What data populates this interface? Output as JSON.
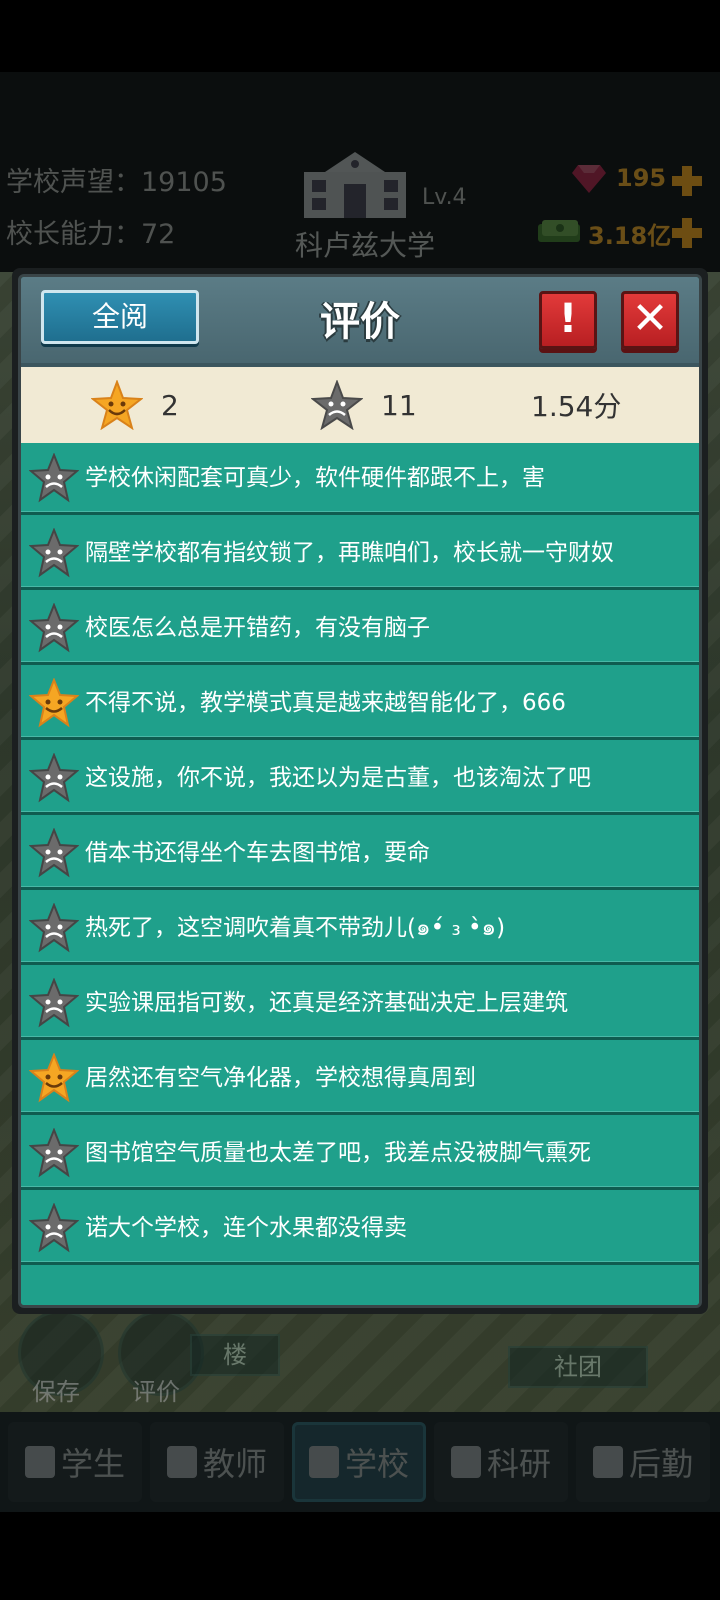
{
  "hud": {
    "reputation": "学校声望：19105",
    "principal": "校长能力：72",
    "level": "Lv.4",
    "school_name": "科卢兹大学",
    "gems": "195",
    "money": "3.18亿"
  },
  "bottom": {
    "save_label": "保存",
    "review_label": "评价",
    "sign_left": "楼",
    "sign_right": "社团"
  },
  "tabs": [
    {
      "label": "学生"
    },
    {
      "label": "教师"
    },
    {
      "label": "学校"
    },
    {
      "label": "科研"
    },
    {
      "label": "后勤"
    }
  ],
  "dialog": {
    "read_all": "全阅",
    "title": "评价",
    "alert_icon": "!",
    "close_icon": "✕",
    "good_count": "2",
    "bad_count": "11",
    "score": "1.54分"
  },
  "reviews": [
    {
      "text": "学校休闲配套可真少，软件硬件都跟不上，害",
      "type": "bad"
    },
    {
      "text": "隔壁学校都有指纹锁了，再瞧咱们，校长就一守财奴",
      "type": "bad"
    },
    {
      "text": "校医怎么总是开错药，有没有脑子",
      "type": "bad"
    },
    {
      "text": "不得不说，教学模式真是越来越智能化了，666",
      "type": "good"
    },
    {
      "text": "这设施，你不说，我还以为是古董，也该淘汰了吧",
      "type": "bad"
    },
    {
      "text": "借本书还得坐个车去图书馆，要命",
      "type": "bad"
    },
    {
      "text": "热死了，这空调吹着真不带劲儿(๑•́ ₃ •̀๑)",
      "type": "bad"
    },
    {
      "text": "实验课屈指可数，还真是经济基础决定上层建筑",
      "type": "bad"
    },
    {
      "text": "居然还有空气净化器，学校想得真周到",
      "type": "good"
    },
    {
      "text": "图书馆空气质量也太差了吧，我差点没被脚气熏死",
      "type": "bad"
    },
    {
      "text": "诺大个学校，连个水果都没得卖",
      "type": "bad"
    }
  ],
  "colors": {
    "panel": "#1fa08b",
    "star_good": "#f5a623",
    "star_bad": "#6b6b6b"
  }
}
